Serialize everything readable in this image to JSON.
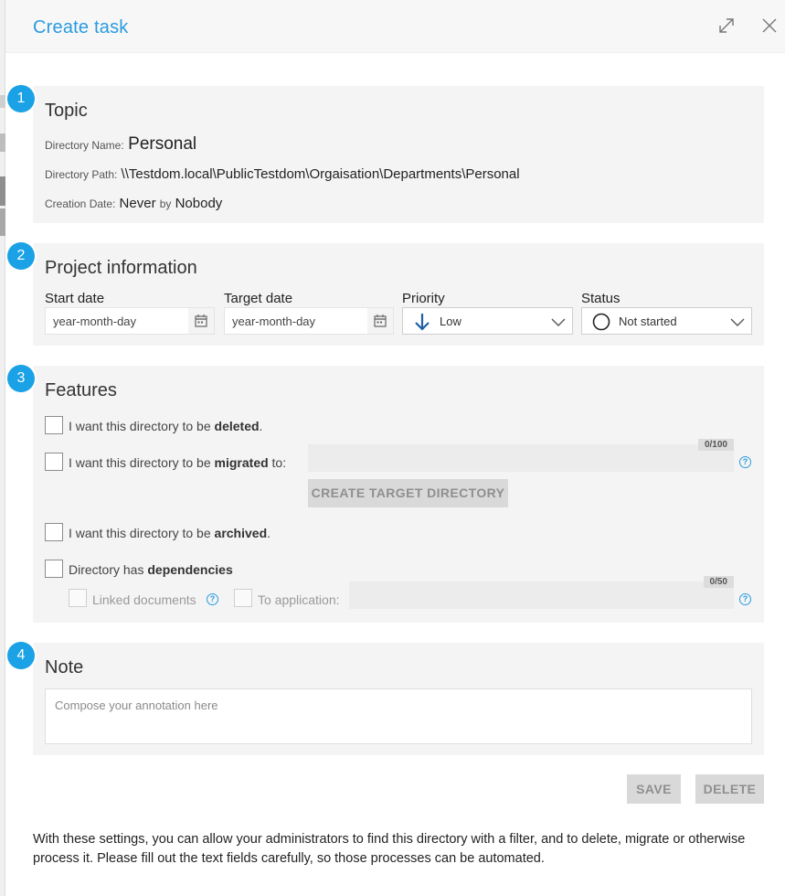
{
  "dialog": {
    "title": "Create task"
  },
  "topic": {
    "number": "1",
    "title": "Topic",
    "directory_name_label": "Directory Name:",
    "directory_name": "Personal",
    "directory_path_label": "Directory Path:",
    "directory_path": "\\\\Testdom.local\\PublicTestdom\\Orgaisation\\Departments\\Personal",
    "creation_date_label": "Creation Date:",
    "creation_date": "Never",
    "by_label": "by",
    "created_by": "Nobody"
  },
  "project": {
    "number": "2",
    "title": "Project information",
    "start_date_label": "Start date",
    "start_date_placeholder": "year-month-day",
    "target_date_label": "Target date",
    "target_date_placeholder": "year-month-day",
    "priority_label": "Priority",
    "priority_value": "Low",
    "priority_icon": "arrow-down-icon",
    "status_label": "Status",
    "status_value": "Not started",
    "status_icon": "circle-icon"
  },
  "features": {
    "number": "3",
    "title": "Features",
    "deleted": {
      "prefix": "I want this directory to be ",
      "bold": "deleted",
      "suffix": "."
    },
    "migrated": {
      "prefix": "I want this directory to be ",
      "bold": "migrated",
      "suffix": " to:",
      "counter": "0/100"
    },
    "create_target_button": "CREATE TARGET DIRECTORY",
    "archived": {
      "prefix": "I want this directory to be ",
      "bold": "archived",
      "suffix": "."
    },
    "dependencies": {
      "prefix": "Directory has ",
      "bold": "dependencies"
    },
    "linked_documents_label": "Linked documents",
    "to_application_label": "To application:",
    "application_counter": "0/50"
  },
  "note": {
    "number": "4",
    "title": "Note",
    "placeholder": "Compose your annotation here"
  },
  "actions": {
    "save_label": "SAVE",
    "delete_label": "DELETE"
  },
  "footer": {
    "text": "With these settings, you can allow your administrators to find this directory with a filter, and to delete, migrate or otherwise process it. Please fill out the text fields carefully, so those processes can be automated."
  },
  "colors": {
    "accent": "#2a9be0",
    "badge": "#1aa1e6",
    "priority_arrow": "#1f5fa8"
  }
}
